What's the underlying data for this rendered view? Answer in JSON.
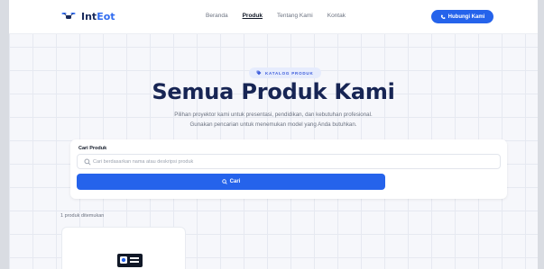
{
  "brand": {
    "name_part1": "Int",
    "name_part2": "Eot",
    "logo_icon": "drone-icon"
  },
  "nav": {
    "items": [
      {
        "label": "Beranda",
        "active": false
      },
      {
        "label": "Produk",
        "active": true
      },
      {
        "label": "Tentang Kami",
        "active": false
      },
      {
        "label": "Kontak",
        "active": false
      }
    ]
  },
  "header": {
    "cta_label": "Hubungi Kami",
    "cta_icon": "phone-icon"
  },
  "hero": {
    "badge": "KATALOG PRODUK",
    "badge_icon": "tag-icon",
    "title": "Semua Produk Kami",
    "subtitle_line1": "Pilihan proyektor kami untuk presentasi, pendidikan, dan kebutuhan profesional.",
    "subtitle_line2": "Gunakan pencarian untuk menemukan model yang Anda butuhkan."
  },
  "search": {
    "label": "Cari Produk",
    "placeholder": "Cari berdasarkan nama atau deskripsi produk",
    "value": "",
    "button_label": "Cari"
  },
  "results": {
    "count_text": "1 produk ditemukan",
    "product_icon": "projector-icon"
  },
  "colors": {
    "primary": "#2563eb",
    "title": "#172554",
    "background": "#f6f7fb"
  }
}
